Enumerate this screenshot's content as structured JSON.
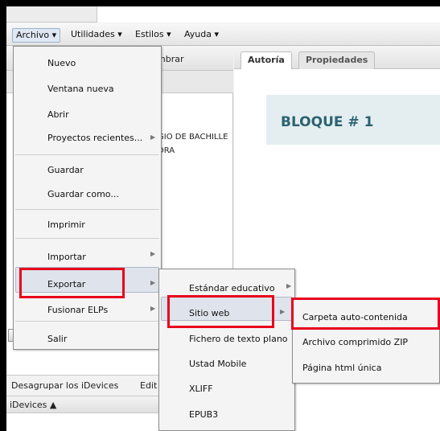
{
  "menubar": {
    "items": [
      "Archivo ▾",
      "Utilidades ▾",
      "Estilos ▾",
      "Ayuda ▾"
    ]
  },
  "left_panel": {
    "tab_fragment": "mbrar",
    "tree_lines": [
      "GIO DE BACHILLE",
      "DRA"
    ],
    "nav_buttons": [
      "⤒",
      "⤓",
      "▲",
      "▼"
    ],
    "actions": [
      "Desagrupar los iDevices",
      "Edit"
    ],
    "idevices_header": "iDevices ▲"
  },
  "right_panel": {
    "tabs": [
      "Autoría",
      "Propiedades"
    ],
    "block_title": "BLOQUE # 1"
  },
  "archivo_menu": {
    "items": [
      "Nuevo",
      "Ventana nueva",
      "Abrir",
      "Proyectos recientes...",
      "Guardar",
      "Guardar como...",
      "Imprimir",
      "Importar",
      "Exportar",
      "Fusionar ELPs",
      "Salir"
    ]
  },
  "exportar_menu": {
    "items": [
      "Estándar educativo",
      "Sitio web",
      "Fichero de texto plano",
      "Ustad Mobile",
      "XLIFF",
      "EPUB3"
    ]
  },
  "sitio_web_menu": {
    "items": [
      "Carpeta auto-contenida",
      "Archivo comprimido ZIP",
      "Página html única"
    ]
  },
  "colors": {
    "highlight_red": "#e8001c",
    "block_text": "#2b6271",
    "block_bg": "#e4eef0"
  }
}
